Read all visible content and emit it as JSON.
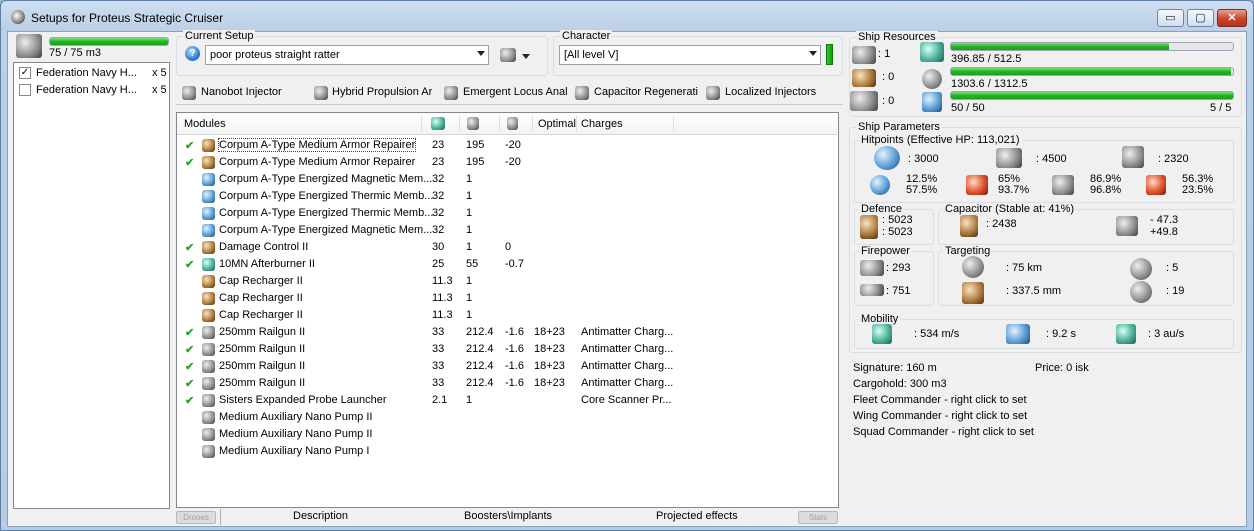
{
  "window": {
    "title": "Setups for Proteus Strategic Cruiser",
    "minimize": "▭",
    "maximize": "▢",
    "close": "✕"
  },
  "drones": {
    "bay": "75 / 75 m3",
    "bay_fraction": 1.0,
    "items": [
      {
        "label": "Federation Navy H...",
        "qty": "x 5",
        "checked": true
      },
      {
        "label": "Federation Navy H...",
        "qty": "x 5",
        "checked": false
      }
    ]
  },
  "setup": {
    "label": "Current Setup",
    "value": "poor proteus straight ratter",
    "help": "?"
  },
  "character": {
    "label": "Character",
    "value": "[All level V]"
  },
  "subsystems": [
    "Nanobot Injector",
    "Hybrid Propulsion Ar",
    "Emergent Locus Anal",
    "Capacitor Regenerati",
    "Localized Injectors"
  ],
  "modules": {
    "header": {
      "name": "Modules",
      "optimal": "Optimal",
      "charges": "Charges"
    },
    "rows": [
      {
        "name": "Corpum A-Type Medium Armor Repairer",
        "active": true,
        "cpu": "23",
        "pg": "195",
        "cap": "-20",
        "optimal": "",
        "charge": "",
        "icon": "armor-repairer-icon",
        "selected": true
      },
      {
        "name": "Corpum A-Type Medium Armor Repairer",
        "active": true,
        "cpu": "23",
        "pg": "195",
        "cap": "-20",
        "optimal": "",
        "charge": "",
        "icon": "armor-repairer-icon"
      },
      {
        "name": "Corpum A-Type Energized Magnetic Mem...",
        "active": false,
        "cpu": "32",
        "pg": "1",
        "cap": "",
        "optimal": "",
        "charge": "",
        "icon": "armor-membrane-icon"
      },
      {
        "name": "Corpum A-Type Energized Thermic Memb...",
        "active": false,
        "cpu": "32",
        "pg": "1",
        "cap": "",
        "optimal": "",
        "charge": "",
        "icon": "armor-membrane-icon"
      },
      {
        "name": "Corpum A-Type Energized Thermic Memb...",
        "active": false,
        "cpu": "32",
        "pg": "1",
        "cap": "",
        "optimal": "",
        "charge": "",
        "icon": "armor-membrane-icon"
      },
      {
        "name": "Corpum A-Type Energized Magnetic Mem...",
        "active": false,
        "cpu": "32",
        "pg": "1",
        "cap": "",
        "optimal": "",
        "charge": "",
        "icon": "armor-membrane-icon"
      },
      {
        "name": "Damage Control II",
        "active": true,
        "cpu": "30",
        "pg": "1",
        "cap": "0",
        "optimal": "",
        "charge": "",
        "icon": "damage-control-icon"
      },
      {
        "name": "10MN Afterburner II",
        "active": true,
        "cpu": "25",
        "pg": "55",
        "cap": "-0.7",
        "optimal": "",
        "charge": "",
        "icon": "afterburner-icon"
      },
      {
        "name": "Cap Recharger II",
        "active": false,
        "cpu": "11.3",
        "pg": "1",
        "cap": "",
        "optimal": "",
        "charge": "",
        "icon": "cap-recharger-icon"
      },
      {
        "name": "Cap Recharger II",
        "active": false,
        "cpu": "11.3",
        "pg": "1",
        "cap": "",
        "optimal": "",
        "charge": "",
        "icon": "cap-recharger-icon"
      },
      {
        "name": "Cap Recharger II",
        "active": false,
        "cpu": "11.3",
        "pg": "1",
        "cap": "",
        "optimal": "",
        "charge": "",
        "icon": "cap-recharger-icon"
      },
      {
        "name": "250mm Railgun II",
        "active": true,
        "cpu": "33",
        "pg": "212.4",
        "cap": "-1.6",
        "optimal": "18+23",
        "charge": "Antimatter Charg...",
        "icon": "railgun-icon"
      },
      {
        "name": "250mm Railgun II",
        "active": true,
        "cpu": "33",
        "pg": "212.4",
        "cap": "-1.6",
        "optimal": "18+23",
        "charge": "Antimatter Charg...",
        "icon": "railgun-icon"
      },
      {
        "name": "250mm Railgun II",
        "active": true,
        "cpu": "33",
        "pg": "212.4",
        "cap": "-1.6",
        "optimal": "18+23",
        "charge": "Antimatter Charg...",
        "icon": "railgun-icon"
      },
      {
        "name": "250mm Railgun II",
        "active": true,
        "cpu": "33",
        "pg": "212.4",
        "cap": "-1.6",
        "optimal": "18+23",
        "charge": "Antimatter Charg...",
        "icon": "railgun-icon"
      },
      {
        "name": "Sisters Expanded Probe Launcher",
        "active": true,
        "cpu": "2.1",
        "pg": "1",
        "cap": "",
        "optimal": "",
        "charge": "Core Scanner Pr...",
        "icon": "probe-launcher-icon"
      },
      {
        "name": "Medium Auxiliary Nano Pump II",
        "active": false,
        "cpu": "",
        "pg": "",
        "cap": "",
        "optimal": "",
        "charge": "",
        "icon": "rig-icon"
      },
      {
        "name": "Medium Auxiliary Nano Pump II",
        "active": false,
        "cpu": "",
        "pg": "",
        "cap": "",
        "optimal": "",
        "charge": "",
        "icon": "rig-icon"
      },
      {
        "name": "Medium Auxiliary Nano Pump I",
        "active": false,
        "cpu": "",
        "pg": "",
        "cap": "",
        "optimal": "",
        "charge": "",
        "icon": "rig-icon"
      }
    ]
  },
  "bottom_tabs": {
    "drones": "Drones",
    "description": "Description",
    "boosters": "Boosters\\Implants",
    "projected": "Projected effects",
    "stats": "Stats"
  },
  "resources": {
    "label": "Ship Resources",
    "turrets": ": 1",
    "launchers": ": 0",
    "drones": ": 0",
    "cpu": {
      "text": "396.85 / 512.5",
      "fraction": 0.774
    },
    "powergrid": {
      "text": "1303.6 / 1312.5",
      "fraction": 0.993
    },
    "calibration": {
      "text": "50 / 50",
      "fraction": 1.0,
      "rigs": "5 / 5"
    }
  },
  "params": {
    "label": "Ship Parameters",
    "hitpoints": {
      "label": "Hitpoints (Effective HP: 113,021)",
      "shield": ": 3000",
      "armor": ": 4500",
      "structure": ": 2320",
      "em": [
        "12.5%",
        "57.5%"
      ],
      "thermal": [
        "65%",
        "93.7%"
      ],
      "kinetic": [
        "86.9%",
        "96.8%"
      ],
      "explosive": [
        "56.3%",
        "23.5%"
      ]
    },
    "defence": {
      "label": "Defence",
      "a": ": 5023",
      "b": ": 5023"
    },
    "capacitor": {
      "label": "Capacitor (Stable at: 41%)",
      "amount": ": 2438",
      "use": "- 47.3",
      "recharge": "+49.8"
    },
    "firepower": {
      "label": "Firepower",
      "turret": ": 293",
      "volley": ": 751"
    },
    "targeting": {
      "label": "Targeting",
      "range": ": 75 km",
      "resolution": ": 337.5 mm",
      "max_targets": ": 5",
      "sensor": ": 19"
    },
    "mobility": {
      "label": "Mobility",
      "speed": ": 534 m/s",
      "align": ": 9.2 s",
      "warp": ": 3 au/s"
    },
    "signature": "Signature: 160 m",
    "price": "Price: 0 isk",
    "cargohold": "Cargohold: 300 m3",
    "fleet": "Fleet Commander - right click to set",
    "wing": "Wing Commander - right click to set",
    "squad": "Squad Commander - right click to set"
  }
}
